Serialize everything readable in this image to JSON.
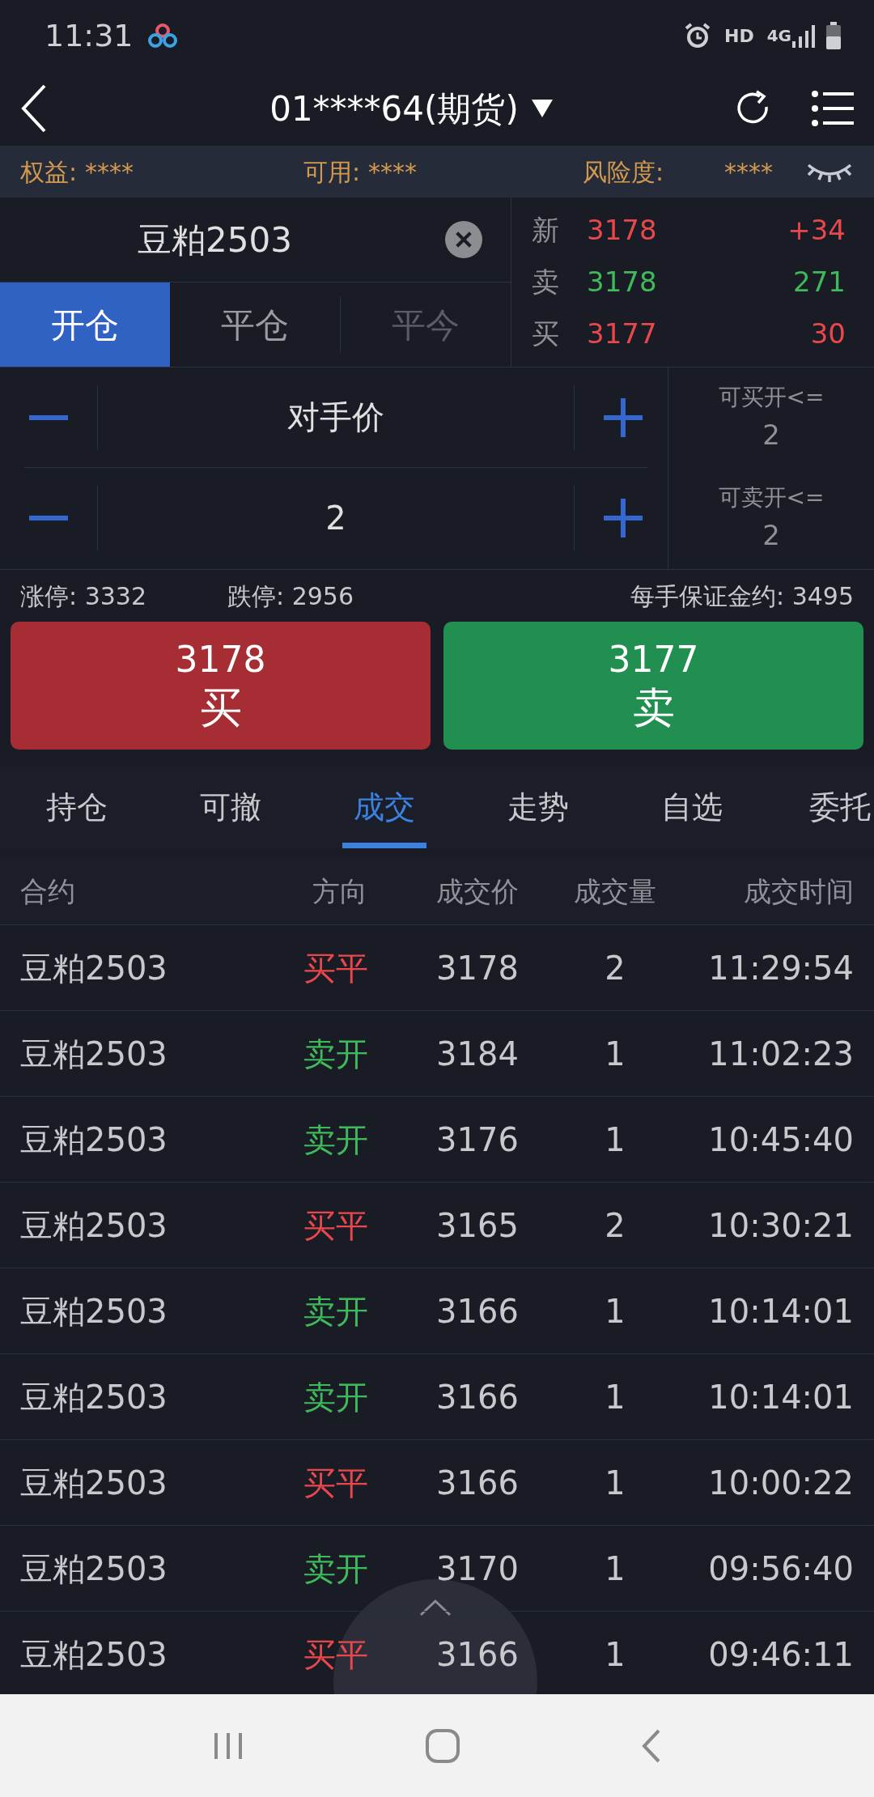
{
  "status_bar": {
    "time": "11:31",
    "hd": "HD",
    "network": "4G"
  },
  "header": {
    "title": "01****64(期货)"
  },
  "account": [
    {
      "label": "权益:",
      "value": "****"
    },
    {
      "label": "可用:",
      "value": "****"
    },
    {
      "label": "风险度:",
      "value": "****"
    }
  ],
  "contract": {
    "value": "豆粕2503"
  },
  "order_tabs": [
    {
      "label": "开仓",
      "selected": true,
      "disabled": false
    },
    {
      "label": "平仓",
      "selected": false,
      "disabled": false
    },
    {
      "label": "平今",
      "selected": false,
      "disabled": true
    }
  ],
  "quote": [
    {
      "label": "新",
      "price": "3178",
      "change": "+34",
      "color": "#e8474c"
    },
    {
      "label": "卖",
      "price": "3178",
      "change": "271",
      "color": "#3fba5a"
    },
    {
      "label": "买",
      "price": "3177",
      "change": "30",
      "color": "#e8474c"
    }
  ],
  "price_field": {
    "value": "对手价"
  },
  "quantity_field": {
    "value": "2"
  },
  "limits": [
    {
      "label": "可买开<=",
      "value": "2"
    },
    {
      "label": "可卖开<=",
      "value": "2"
    }
  ],
  "price_limits": {
    "limit_up": "涨停: 3332",
    "limit_down": "跌停: 2956",
    "margin": "每手保证金约: 3495"
  },
  "actions": [
    {
      "price": "3178",
      "label": "买",
      "kind": "buy"
    },
    {
      "price": "3177",
      "label": "卖",
      "kind": "sell"
    }
  ],
  "bottom_tabs": [
    {
      "label": "持仓",
      "selected": false
    },
    {
      "label": "可撤",
      "selected": false
    },
    {
      "label": "成交",
      "selected": true
    },
    {
      "label": "走势",
      "selected": false
    },
    {
      "label": "自选",
      "selected": false
    },
    {
      "label": "委托",
      "selected": false
    }
  ],
  "table": {
    "columns": [
      "合约",
      "方向",
      "成交价",
      "成交量",
      "成交时间"
    ],
    "rows": [
      {
        "cells": [
          "豆粕2503",
          "买平",
          "3178",
          "2",
          "11:29:54"
        ],
        "color": "#e8474c"
      },
      {
        "cells": [
          "豆粕2503",
          "卖开",
          "3184",
          "1",
          "11:02:23"
        ],
        "color": "#3fba5a"
      },
      {
        "cells": [
          "豆粕2503",
          "卖开",
          "3176",
          "1",
          "10:45:40"
        ],
        "color": "#3fba5a"
      },
      {
        "cells": [
          "豆粕2503",
          "买平",
          "3165",
          "2",
          "10:30:21"
        ],
        "color": "#e8474c"
      },
      {
        "cells": [
          "豆粕2503",
          "卖开",
          "3166",
          "1",
          "10:14:01"
        ],
        "color": "#3fba5a"
      },
      {
        "cells": [
          "豆粕2503",
          "卖开",
          "3166",
          "1",
          "10:14:01"
        ],
        "color": "#3fba5a"
      },
      {
        "cells": [
          "豆粕2503",
          "买平",
          "3166",
          "1",
          "10:00:22"
        ],
        "color": "#e8474c"
      },
      {
        "cells": [
          "豆粕2503",
          "卖开",
          "3170",
          "1",
          "09:56:40"
        ],
        "color": "#3fba5a"
      },
      {
        "cells": [
          "豆粕2503",
          "买平",
          "3166",
          "1",
          "09:46:11"
        ],
        "color": "#e8474c"
      }
    ]
  }
}
